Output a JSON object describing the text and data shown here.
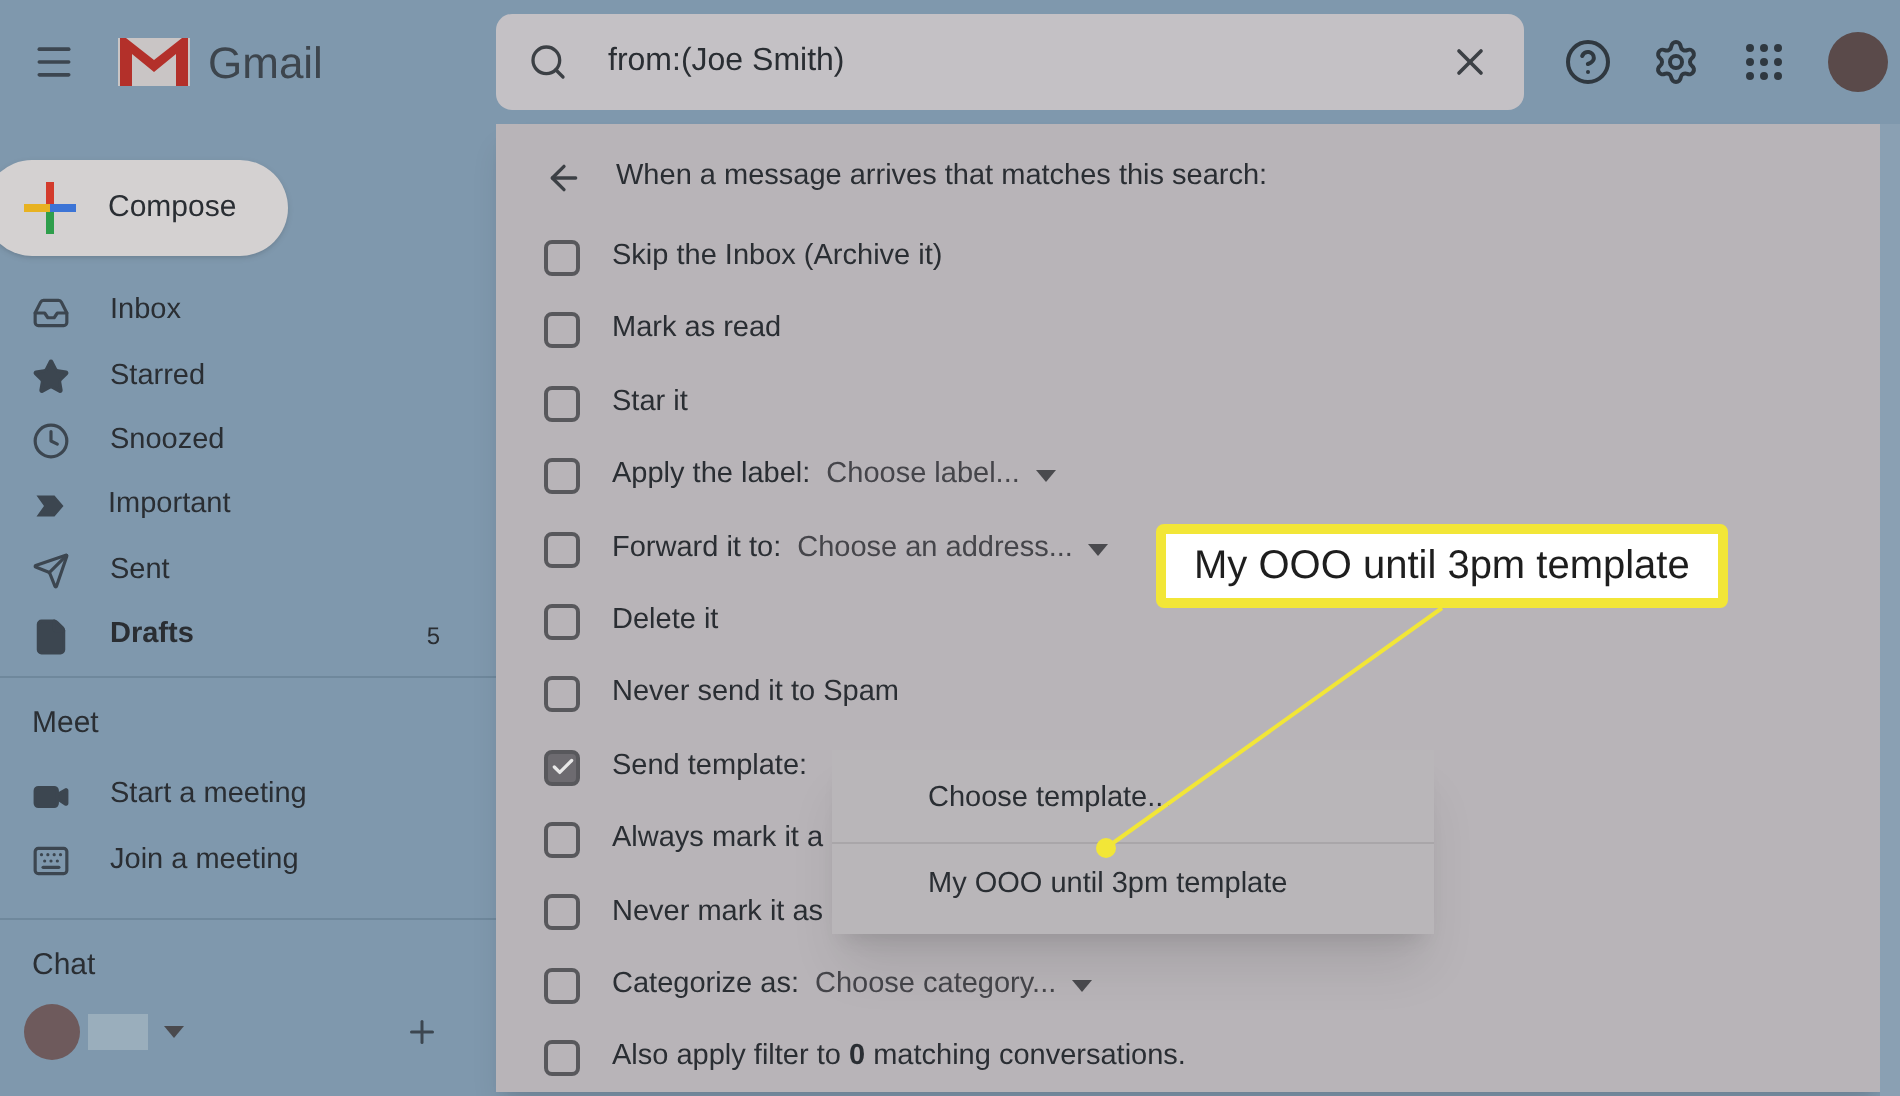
{
  "app": {
    "name": "Gmail"
  },
  "compose": {
    "label": "Compose"
  },
  "nav": [
    {
      "label": "Inbox",
      "bold": false
    },
    {
      "label": "Starred",
      "bold": false
    },
    {
      "label": "Snoozed",
      "bold": false
    },
    {
      "label": "Important",
      "bold": false
    },
    {
      "label": "Sent",
      "bold": false
    },
    {
      "label": "Drafts",
      "bold": true,
      "count": "5"
    }
  ],
  "meet": {
    "title": "Meet",
    "items": [
      "Start a meeting",
      "Join a meeting"
    ]
  },
  "chat": {
    "title": "Chat"
  },
  "search": {
    "value": "from:(Joe Smith)"
  },
  "filter": {
    "heading": "When a message arrives that matches this search:",
    "options": [
      {
        "label": "Skip the Inbox (Archive it)",
        "checked": false
      },
      {
        "label": "Mark as read",
        "checked": false
      },
      {
        "label": "Star it",
        "checked": false
      },
      {
        "label": "Apply the label:",
        "checked": false,
        "dropdown": "Choose label..."
      },
      {
        "label": "Forward it to:",
        "checked": false,
        "dropdown": "Choose an address..."
      },
      {
        "label": "Delete it",
        "checked": false
      },
      {
        "label": "Never send it to Spam",
        "checked": false
      },
      {
        "label": "Send template:",
        "checked": true
      },
      {
        "label": "Always mark it a",
        "checked": false
      },
      {
        "label": "Never mark it as",
        "checked": false
      },
      {
        "label": "Categorize as:",
        "checked": false,
        "dropdown": "Choose category..."
      },
      {
        "label": "Also apply filter to **0** matching conversations.",
        "checked": false
      }
    ]
  },
  "menu": {
    "items": [
      "Choose template...",
      "My OOO until 3pm template"
    ]
  },
  "callout": {
    "text": "My OOO until 3pm template"
  }
}
